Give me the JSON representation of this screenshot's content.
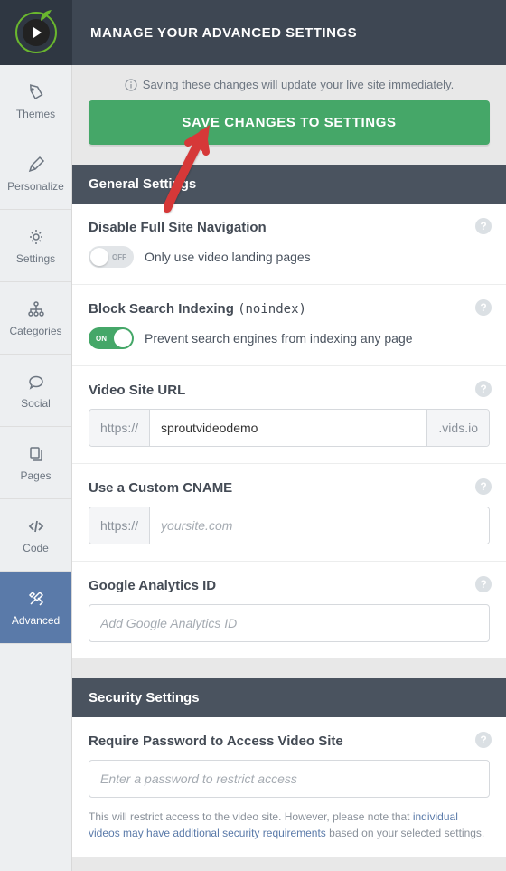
{
  "header": {
    "title": "MANAGE YOUR ADVANCED SETTINGS"
  },
  "sidebar": {
    "items": [
      {
        "label": "Themes"
      },
      {
        "label": "Personalize"
      },
      {
        "label": "Settings"
      },
      {
        "label": "Categories"
      },
      {
        "label": "Social"
      },
      {
        "label": "Pages"
      },
      {
        "label": "Code"
      },
      {
        "label": "Advanced"
      }
    ]
  },
  "notice": {
    "text": "Saving these changes will update your live site immediately."
  },
  "save_button": {
    "label": "SAVE CHANGES TO SETTINGS"
  },
  "general": {
    "header": "General Settings",
    "disable_nav": {
      "title": "Disable Full Site Navigation",
      "toggle_state": "OFF",
      "desc": "Only use video landing pages"
    },
    "block_index": {
      "title_prefix": "Block Search Indexing",
      "title_code": "(noindex)",
      "toggle_state": "ON",
      "desc": "Prevent search engines from indexing any page"
    },
    "site_url": {
      "title": "Video Site URL",
      "prefix": "https://",
      "value": "sproutvideodemo",
      "suffix": ".vids.io"
    },
    "cname": {
      "title": "Use a Custom CNAME",
      "prefix": "https://",
      "placeholder": "yoursite.com"
    },
    "ga": {
      "title": "Google Analytics ID",
      "placeholder": "Add Google Analytics ID"
    }
  },
  "security": {
    "header": "Security Settings",
    "password": {
      "title": "Require Password to Access Video Site",
      "placeholder": "Enter a password to restrict access",
      "helper_prefix": "This will restrict access to the video site. However, please note that ",
      "helper_link": "individual videos may have additional security requirements",
      "helper_suffix": " based on your selected settings."
    }
  }
}
